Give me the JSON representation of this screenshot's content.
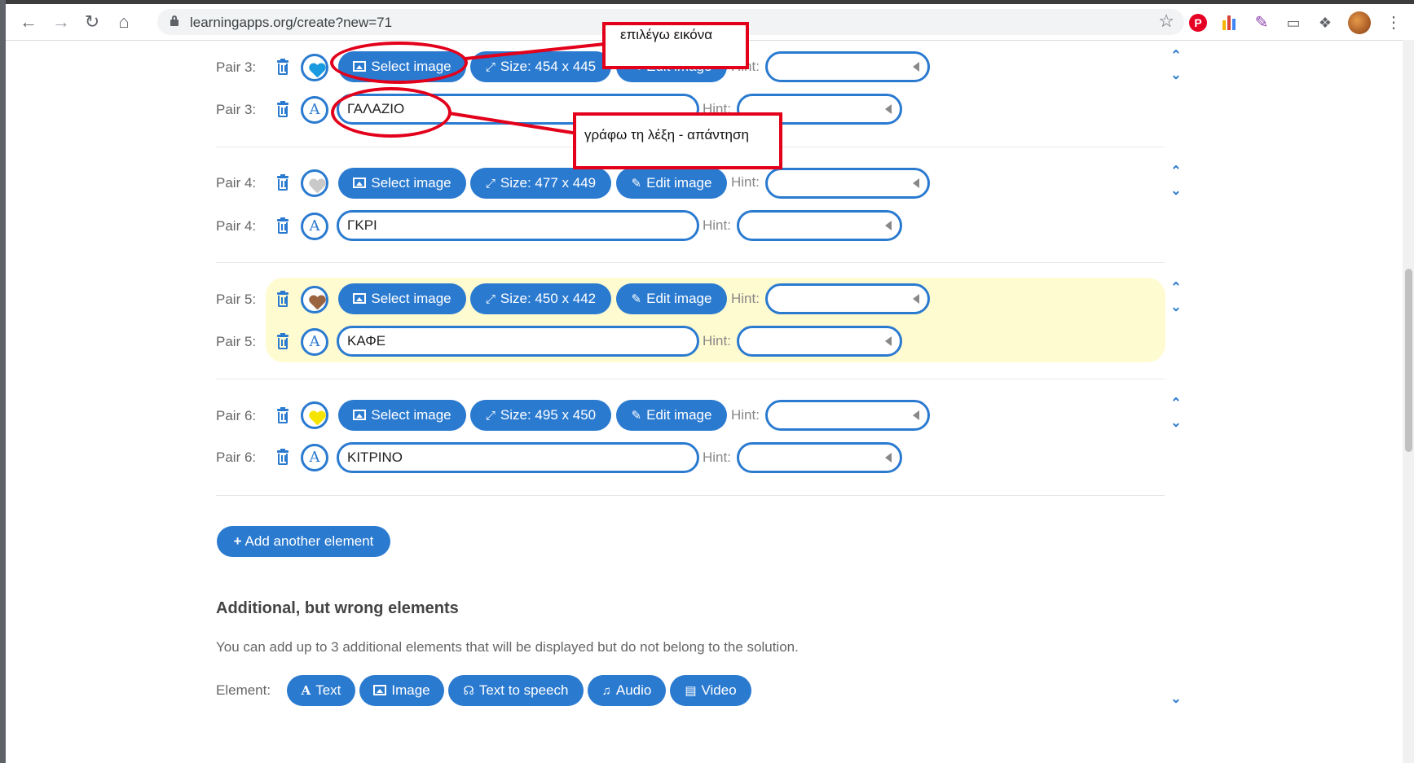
{
  "browser": {
    "url": "learningapps.org/create?new=71"
  },
  "pairs": [
    {
      "label": "Pair 3:",
      "heart_color": "#1a9be0",
      "select_label": "Select image",
      "size_label": "Size: 454 x 445",
      "edit_label": "Edit image",
      "hint_label": "Hint:",
      "text_label": "Pair 3:",
      "text_value": "ΓΑΛΑΖΙΟ",
      "text_hint_label": "Hint:"
    },
    {
      "label": "Pair 4:",
      "heart_color": "#c9c9c9",
      "select_label": "Select image",
      "size_label": "Size: 477 x 449",
      "edit_label": "Edit image",
      "hint_label": "Hint:",
      "text_label": "Pair 4:",
      "text_value": "ΓΚΡΙ",
      "text_hint_label": "Hint:"
    },
    {
      "label": "Pair 5:",
      "heart_color": "#9a6440",
      "select_label": "Select image",
      "size_label": "Size: 450 x 442",
      "edit_label": "Edit image",
      "hint_label": "Hint:",
      "text_label": "Pair 5:",
      "text_value": "ΚΑΦΕ",
      "text_hint_label": "Hint:"
    },
    {
      "label": "Pair 6:",
      "heart_color": "#f5e400",
      "select_label": "Select image",
      "size_label": "Size: 495 x 450",
      "edit_label": "Edit image",
      "hint_label": "Hint:",
      "text_label": "Pair 6:",
      "text_value": "ΚΙΤΡΙΝΟ",
      "text_hint_label": "Hint:"
    }
  ],
  "text_icon_glyph": "A",
  "add_button_label": "Add another element",
  "additional": {
    "heading": "Additional, but wrong elements",
    "description": "You can add up to 3 additional elements that will be displayed but do not belong to the solution.",
    "element_label": "Element:",
    "types": [
      "Text",
      "Image",
      "Text to speech",
      "Audio",
      "Video"
    ]
  },
  "annotations": {
    "select_image_note": "επιλέγω εικόνα",
    "write_word_note": "γράφω τη λέξη - απάντηση"
  },
  "colors": {
    "accent": "#2a7ad0",
    "annotation_red": "#e3001b",
    "highlight_row": "#fffbd0"
  }
}
